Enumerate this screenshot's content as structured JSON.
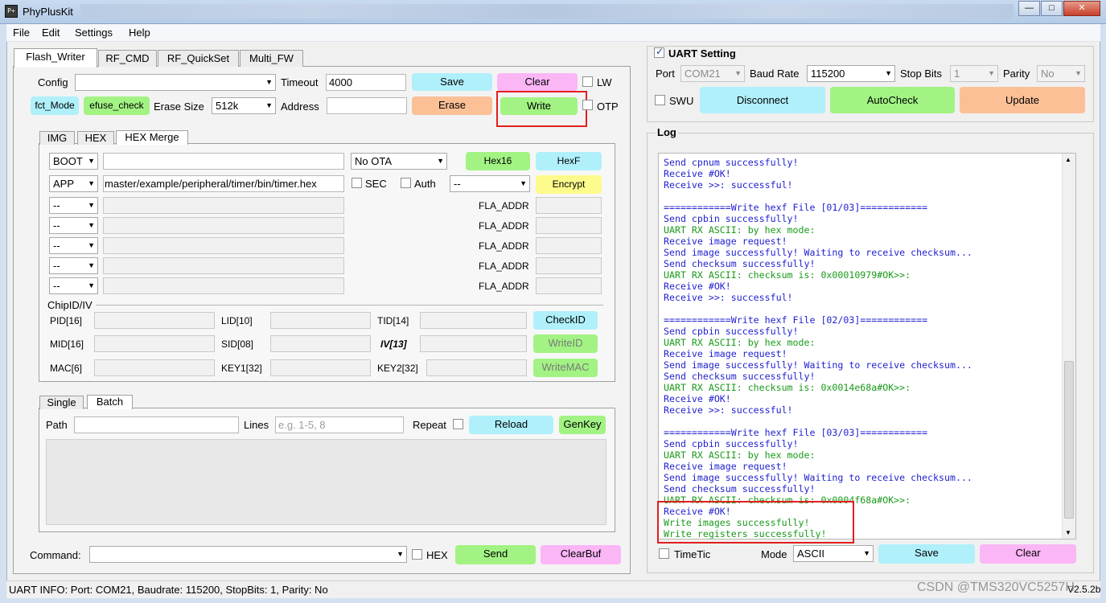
{
  "window": {
    "title": "PhyPlusKit",
    "icon_text": "P+",
    "minimize": "0",
    "maximize": "1",
    "close": "r"
  },
  "menu": [
    "File",
    "Edit",
    "Settings",
    "Help"
  ],
  "main_tabs": [
    "Flash_Writer",
    "RF_CMD",
    "RF_QuickSet",
    "Multi_FW"
  ],
  "flash": {
    "config_label": "Config",
    "config_value": "",
    "timeout_label": "Timeout",
    "timeout_value": "4000",
    "save": "Save",
    "clear": "Clear",
    "lw": "LW",
    "fct_mode": "fct_Mode",
    "efuse_check": "efuse_check",
    "erase_size_label": "Erase Size",
    "erase_size_value": "512k",
    "address_label": "Address",
    "address_value": "",
    "erase": "Erase",
    "write": "Write",
    "otp": "OTP"
  },
  "sub_tabs": [
    "IMG",
    "HEX",
    "HEX Merge"
  ],
  "hexmerge": {
    "row1_type": "BOOT",
    "row1_path": "",
    "ota": "No OTA",
    "hex16": "Hex16",
    "hexf": "HexF",
    "row2_type": "APP",
    "row2_path": "master/example/peripheral/timer/bin/timer.hex",
    "sec": "SEC",
    "auth": "Auth",
    "enc_mode": "--",
    "encrypt": "Encrypt",
    "empty_type": "--",
    "fla_addr": "FLA_ADDR"
  },
  "chip": {
    "title": "ChipID/IV",
    "pid": "PID[16]",
    "lid": "LID[10]",
    "tid": "TID[14]",
    "checkid": "CheckID",
    "mid": "MID[16]",
    "sid": "SID[08]",
    "iv": "IV[13]",
    "writeid": "WriteID",
    "mac": "MAC[6]",
    "key1": "KEY1[32]",
    "key2": "KEY2[32]",
    "writemac": "WriteMAC"
  },
  "batch_tabs": [
    "Single",
    "Batch"
  ],
  "batch": {
    "path_label": "Path",
    "lines_label": "Lines",
    "lines_placeholder": "e.g. 1-5, 8",
    "repeat": "Repeat",
    "reload": "Reload",
    "genkey": "GenKey"
  },
  "command": {
    "label": "Command:",
    "hex": "HEX",
    "send": "Send",
    "clearbuf": "ClearBuf"
  },
  "uart": {
    "title": "UART Setting",
    "port_label": "Port",
    "port_value": "COM21",
    "baud_label": "Baud Rate",
    "baud_value": "115200",
    "stop_label": "Stop Bits",
    "stop_value": "1",
    "parity_label": "Parity",
    "parity_value": "No",
    "swu": "SWU",
    "disconnect": "Disconnect",
    "autocheck": "AutoCheck",
    "update": "Update"
  },
  "log": {
    "title": "Log",
    "lines": [
      {
        "t": "Send cpnum successfully!",
        "c": "blue"
      },
      {
        "t": "Receive #OK!",
        "c": "blue"
      },
      {
        "t": "Receive >>: successful!",
        "c": "blue"
      },
      {
        "t": "",
        "c": "blue"
      },
      {
        "t": "============Write hexf File [01/03]============",
        "c": "blue"
      },
      {
        "t": "Send cpbin successfully!",
        "c": "blue"
      },
      {
        "t": "UART RX ASCII: by hex mode:",
        "c": "green"
      },
      {
        "t": "Receive image request!",
        "c": "blue"
      },
      {
        "t": "Send image successfully! Waiting to receive checksum...",
        "c": "blue"
      },
      {
        "t": "Send checksum successfully!",
        "c": "blue"
      },
      {
        "t": "UART RX ASCII: checksum is: 0x00010979#OK>>:",
        "c": "green"
      },
      {
        "t": "Receive #OK!",
        "c": "blue"
      },
      {
        "t": "Receive >>: successful!",
        "c": "blue"
      },
      {
        "t": "",
        "c": "blue"
      },
      {
        "t": "============Write hexf File [02/03]============",
        "c": "blue"
      },
      {
        "t": "Send cpbin successfully!",
        "c": "blue"
      },
      {
        "t": "UART RX ASCII: by hex mode:",
        "c": "green"
      },
      {
        "t": "Receive image request!",
        "c": "blue"
      },
      {
        "t": "Send image successfully! Waiting to receive checksum...",
        "c": "blue"
      },
      {
        "t": "Send checksum successfully!",
        "c": "blue"
      },
      {
        "t": "UART RX ASCII: checksum is: 0x0014e68a#OK>>:",
        "c": "green"
      },
      {
        "t": "Receive #OK!",
        "c": "blue"
      },
      {
        "t": "Receive >>: successful!",
        "c": "blue"
      },
      {
        "t": "",
        "c": "blue"
      },
      {
        "t": "============Write hexf File [03/03]============",
        "c": "blue"
      },
      {
        "t": "Send cpbin successfully!",
        "c": "blue"
      },
      {
        "t": "UART RX ASCII: by hex mode:",
        "c": "green"
      },
      {
        "t": "Receive image request!",
        "c": "blue"
      },
      {
        "t": "Send image successfully! Waiting to receive checksum...",
        "c": "blue"
      },
      {
        "t": "Send checksum successfully!",
        "c": "blue"
      },
      {
        "t": "UART RX ASCII: checksum is: 0x0004f68a#OK>>:",
        "c": "green"
      },
      {
        "t": "Receive #OK!",
        "c": "blue"
      },
      {
        "t": "Write images successfully!",
        "c": "green"
      },
      {
        "t": "Write registers successfully!",
        "c": "green"
      }
    ],
    "timetic": "TimeTic",
    "mode_label": "Mode",
    "mode_value": "ASCII",
    "save": "Save",
    "clear": "Clear"
  },
  "status": {
    "text": "UART INFO: Port: COM21, Baudrate: 115200, StopBits: 1, Parity: No",
    "version": "V2.5.2b"
  },
  "watermark": "CSDN @TMS320VC5257H",
  "colors": {
    "cyan": "#aff0fb",
    "pink": "#fbb6f6",
    "green": "#a2f383",
    "orange": "#fbc096",
    "yellow": "#fcfb8c",
    "highlight": "#e31e1e",
    "log_blue": "#1f1fd0",
    "log_green": "#1a9a1a"
  }
}
